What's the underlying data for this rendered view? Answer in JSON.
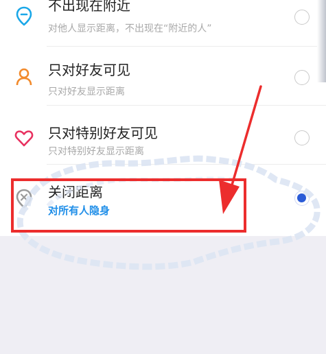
{
  "options": [
    {
      "title": "不出现在附近",
      "subtitle": "对他人显示距离，不出现在“附近的人”",
      "icon": "location-pin-icon",
      "color": "#1aa7e8",
      "selected": false
    },
    {
      "title": "只对好友可见",
      "subtitle": "只对好友显示距离",
      "icon": "person-icon",
      "color": "#f28a2c",
      "selected": false
    },
    {
      "title": "只对特别好友可见",
      "subtitle": "只对特别好友显示距离",
      "icon": "heart-icon",
      "color": "#e8305f",
      "selected": false
    },
    {
      "title": "关闭距离",
      "subtitle": "对所有人隐身",
      "icon": "location-off-icon",
      "color": "#9a9a9a",
      "selected": true
    }
  ],
  "colors": {
    "annotation_red": "#ec2d2d",
    "radio_selected": "#2a5bd7",
    "accent_subtitle": "#1f8ee8",
    "page_background": "#efeef4"
  }
}
